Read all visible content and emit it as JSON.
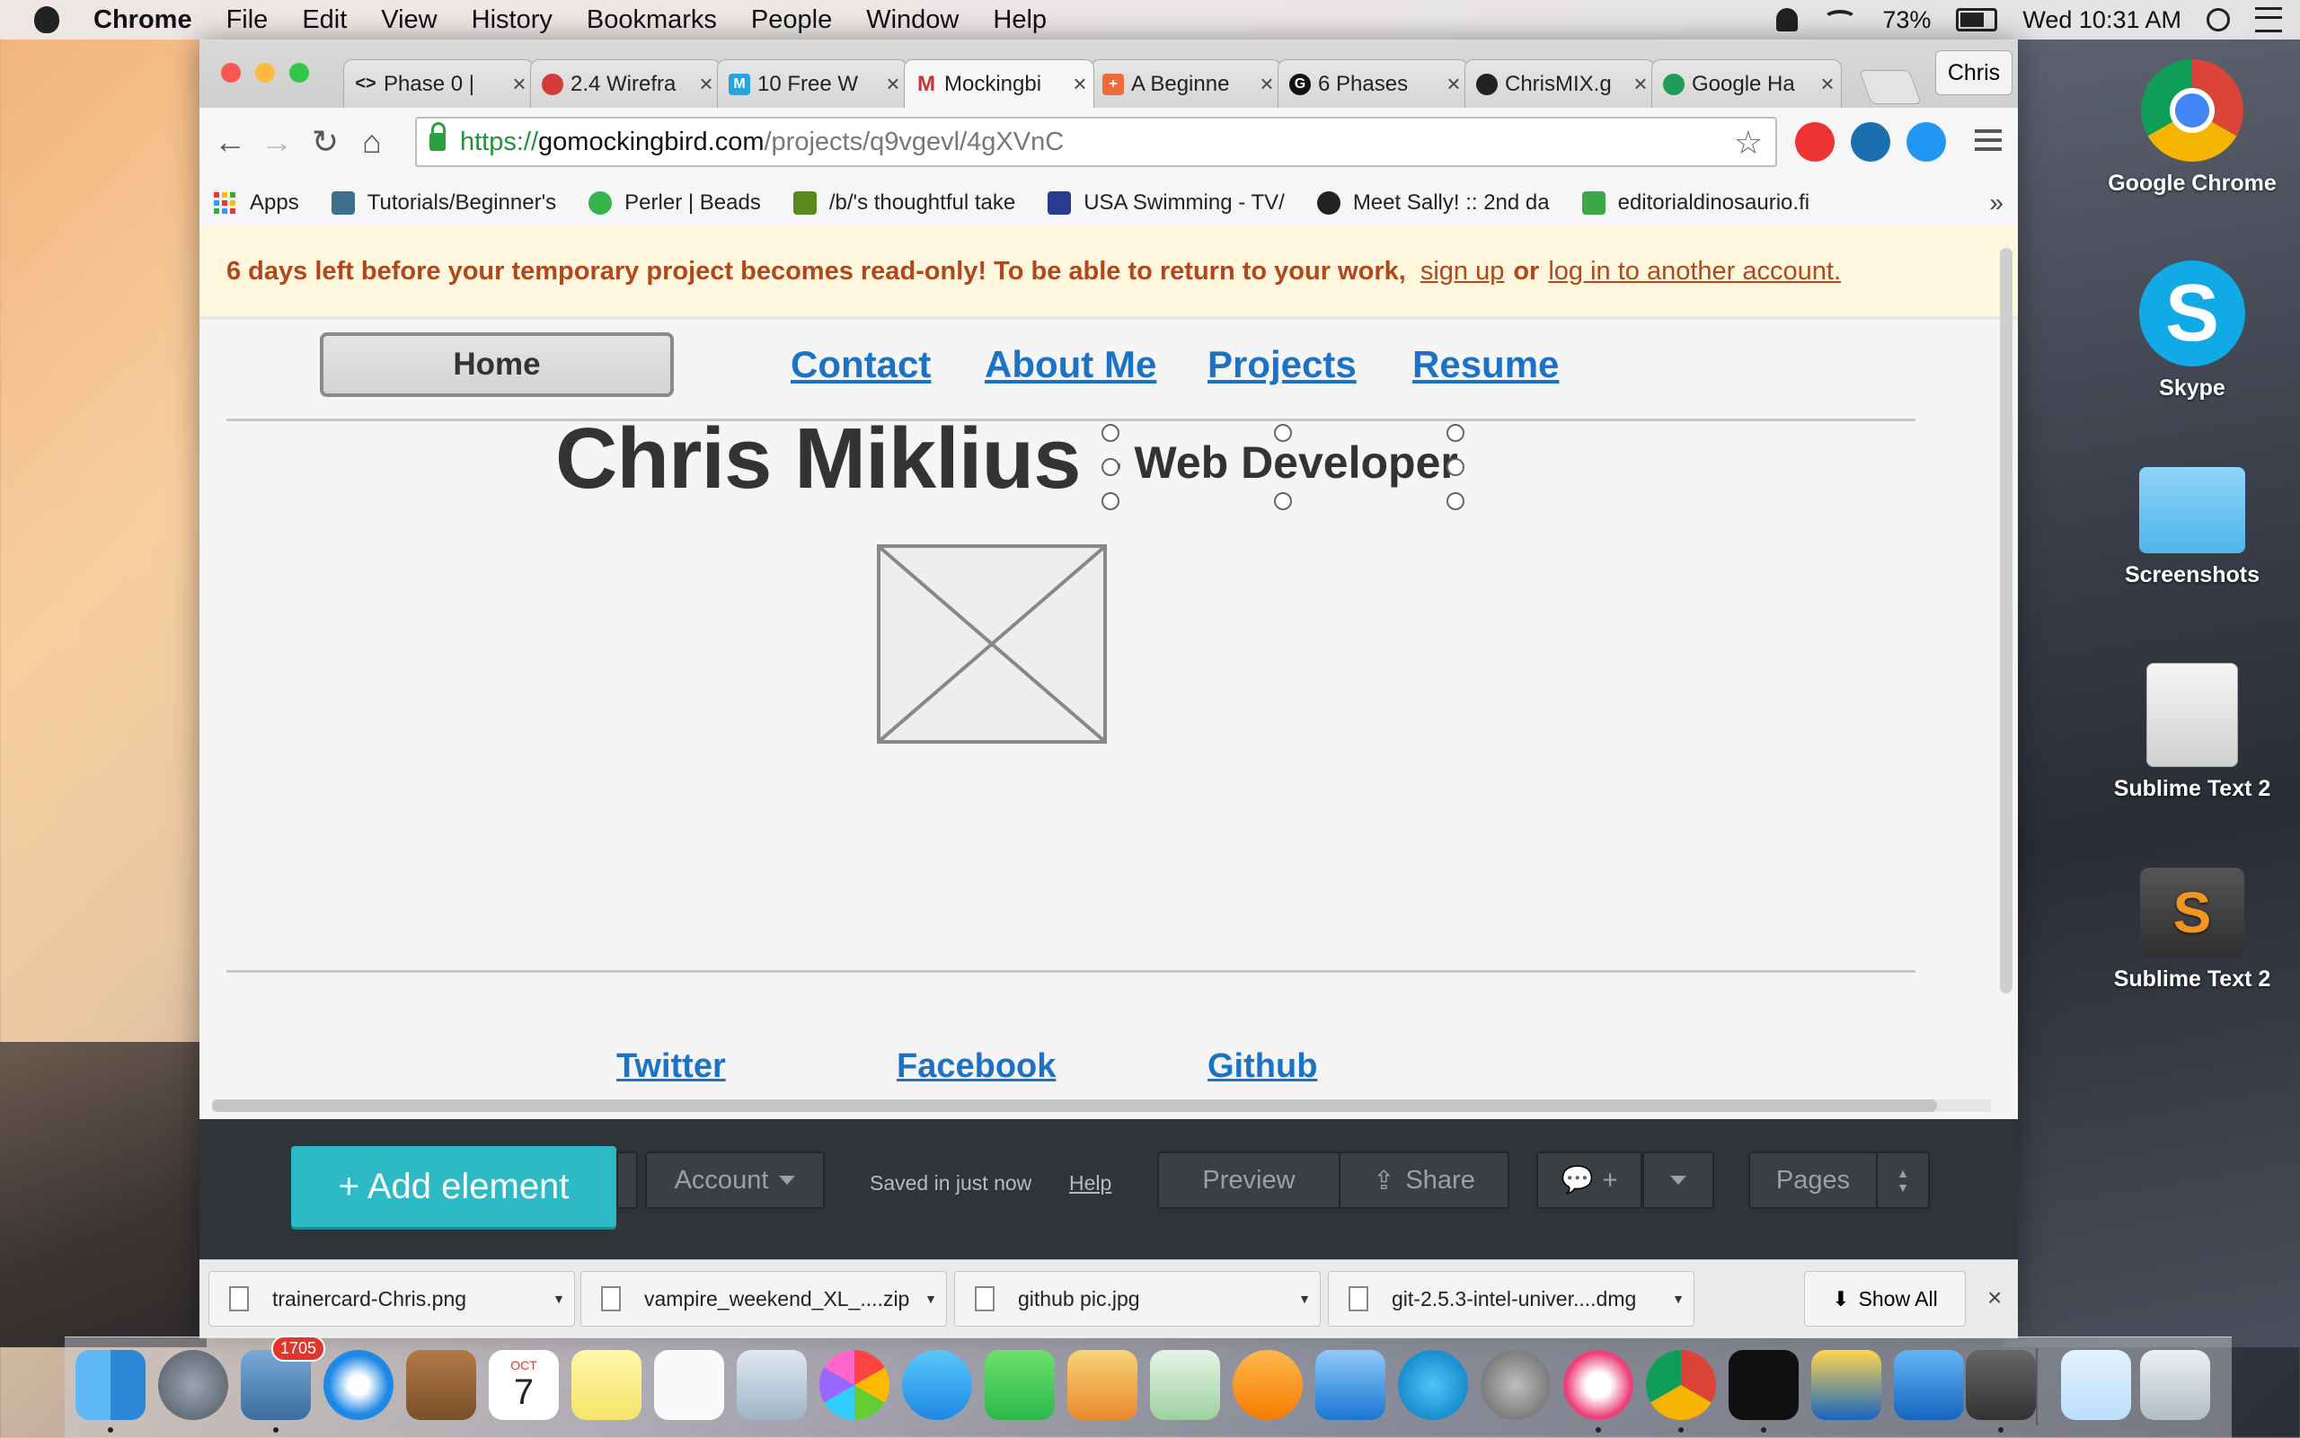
{
  "menubar": {
    "app": "Chrome",
    "items": [
      "File",
      "Edit",
      "View",
      "History",
      "Bookmarks",
      "People",
      "Window",
      "Help"
    ],
    "battery": "73%",
    "clock": "Wed 10:31 AM"
  },
  "browser": {
    "tabs": [
      {
        "title": "Phase 0 | ",
        "icon": "code-icon"
      },
      {
        "title": "2.4 Wirefra",
        "icon": "gear-icon"
      },
      {
        "title": "10 Free W",
        "icon": "m-icon"
      },
      {
        "title": "Mockingbi",
        "icon": "mockingbird-icon"
      },
      {
        "title": "A Beginne",
        "icon": "plus-icon"
      },
      {
        "title": "6 Phases",
        "icon": "g-icon"
      },
      {
        "title": "ChrisMIX.g",
        "icon": "github-icon"
      },
      {
        "title": "Google Ha",
        "icon": "hangouts-icon"
      }
    ],
    "profile": "Chris",
    "url": {
      "scheme": "https://",
      "host": "gomockingbird.com",
      "path": "/projects/q9vgevl/4gXVnC"
    },
    "bookmarks": [
      "Apps",
      "Tutorials/Beginner's",
      "Perler | Beads",
      "/b/'s thoughtful take",
      "USA Swimming - TV/",
      "Meet Sally! :: 2nd da",
      "editorialdinosaurio.fi"
    ],
    "bookmarks_more": "»"
  },
  "banner": {
    "message": "6 days left before your temporary project becomes read-only! To be able to return to your work,",
    "signup": "sign up",
    "or": "or",
    "login": "log in to another account."
  },
  "mockup": {
    "home": "Home",
    "nav": [
      "Contact",
      "About Me",
      "Projects",
      "Resume"
    ],
    "name": "Chris Miklius",
    "role": "- Web Developer",
    "footer_links": [
      "Twitter",
      "Facebook",
      "Github"
    ]
  },
  "editor": {
    "add_element": "+ Add element",
    "account": "Account",
    "saved": "Saved in just now",
    "help": "Help",
    "preview": "Preview",
    "share": "Share",
    "comment": "+",
    "pages": "Pages"
  },
  "downloads": {
    "items": [
      "trainercard-Chris.png",
      "vampire_weekend_XL_....zip",
      "github pic.jpg",
      "git-2.5.3-intel-univer....dmg"
    ],
    "show_all": "Show All"
  },
  "desktop": {
    "icons": [
      "Google Chrome",
      "Skype",
      "Screenshots",
      "Sublime Text 2",
      "Sublime Text 2"
    ]
  },
  "dock": {
    "mail_badge": "1705",
    "calendar_month": "OCT",
    "calendar_day": "7"
  },
  "colors": {
    "link": "#1c73c6",
    "banner_text": "#b0481c",
    "add_element": "#2db9c6",
    "editor_bar": "#2f3438"
  }
}
